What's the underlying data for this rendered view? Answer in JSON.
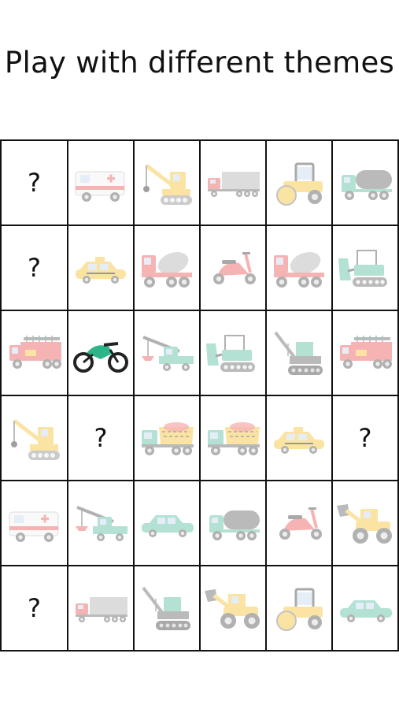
{
  "title": "Play with different themes",
  "theme": "vehicles",
  "colors": {
    "red": "#ef6a6a",
    "yellow": "#f6c94a",
    "teal": "#69c7ad",
    "gray": "#9a9a9a",
    "dark": "#555555"
  },
  "board": {
    "rows": 6,
    "cols": 6,
    "cells": [
      {
        "type": "hidden",
        "label": "?"
      },
      {
        "type": "icon",
        "icon": "ambulance-icon"
      },
      {
        "type": "icon",
        "icon": "crawler-crane-icon"
      },
      {
        "type": "icon",
        "icon": "semi-truck-icon"
      },
      {
        "type": "icon",
        "icon": "road-roller-icon"
      },
      {
        "type": "icon",
        "icon": "tanker-truck-icon"
      },
      {
        "type": "hidden",
        "label": "?"
      },
      {
        "type": "icon",
        "icon": "taxi-icon"
      },
      {
        "type": "icon",
        "icon": "cement-mixer-icon"
      },
      {
        "type": "icon",
        "icon": "scooter-icon"
      },
      {
        "type": "icon",
        "icon": "cement-mixer-icon"
      },
      {
        "type": "icon",
        "icon": "bulldozer-icon"
      },
      {
        "type": "icon",
        "icon": "fire-truck-icon"
      },
      {
        "type": "icon",
        "icon": "motorcycle-icon",
        "highlight": true
      },
      {
        "type": "icon",
        "icon": "tow-truck-icon"
      },
      {
        "type": "icon",
        "icon": "bulldozer-icon"
      },
      {
        "type": "icon",
        "icon": "tower-crane-icon"
      },
      {
        "type": "icon",
        "icon": "fire-truck-icon"
      },
      {
        "type": "icon",
        "icon": "crawler-crane-icon"
      },
      {
        "type": "hidden",
        "label": "?"
      },
      {
        "type": "icon",
        "icon": "dump-truck-icon"
      },
      {
        "type": "icon",
        "icon": "dump-truck-icon"
      },
      {
        "type": "icon",
        "icon": "taxi-icon"
      },
      {
        "type": "hidden",
        "label": "?"
      },
      {
        "type": "icon",
        "icon": "ambulance-icon"
      },
      {
        "type": "icon",
        "icon": "tow-truck-icon"
      },
      {
        "type": "icon",
        "icon": "car-icon"
      },
      {
        "type": "icon",
        "icon": "tanker-truck-icon"
      },
      {
        "type": "icon",
        "icon": "scooter-icon"
      },
      {
        "type": "icon",
        "icon": "wheel-loader-icon"
      },
      {
        "type": "hidden",
        "label": "?"
      },
      {
        "type": "icon",
        "icon": "semi-truck-icon"
      },
      {
        "type": "icon",
        "icon": "tower-crane-icon"
      },
      {
        "type": "icon",
        "icon": "wheel-loader-icon"
      },
      {
        "type": "icon",
        "icon": "road-roller-icon"
      },
      {
        "type": "icon",
        "icon": "car-icon"
      }
    ]
  }
}
